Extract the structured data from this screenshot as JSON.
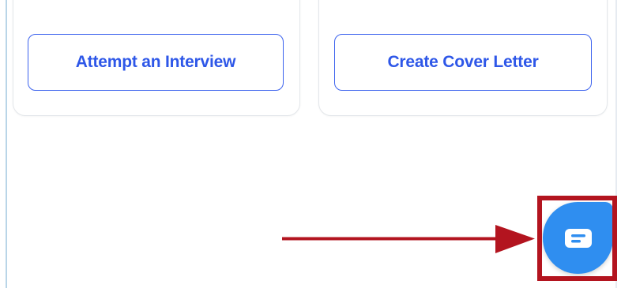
{
  "cards": [
    {
      "button_label": "Attempt an Interview"
    },
    {
      "button_label": "Create Cover Letter"
    }
  ],
  "chat": {
    "icon": "chat-bubble-icon"
  },
  "annotation": {
    "highlight_color": "#b3141f",
    "arrow_color": "#b3141f"
  },
  "colors": {
    "button_border": "#3d63ee",
    "button_text": "#2e57e8",
    "chat_button_bg": "#2f8ef0"
  }
}
